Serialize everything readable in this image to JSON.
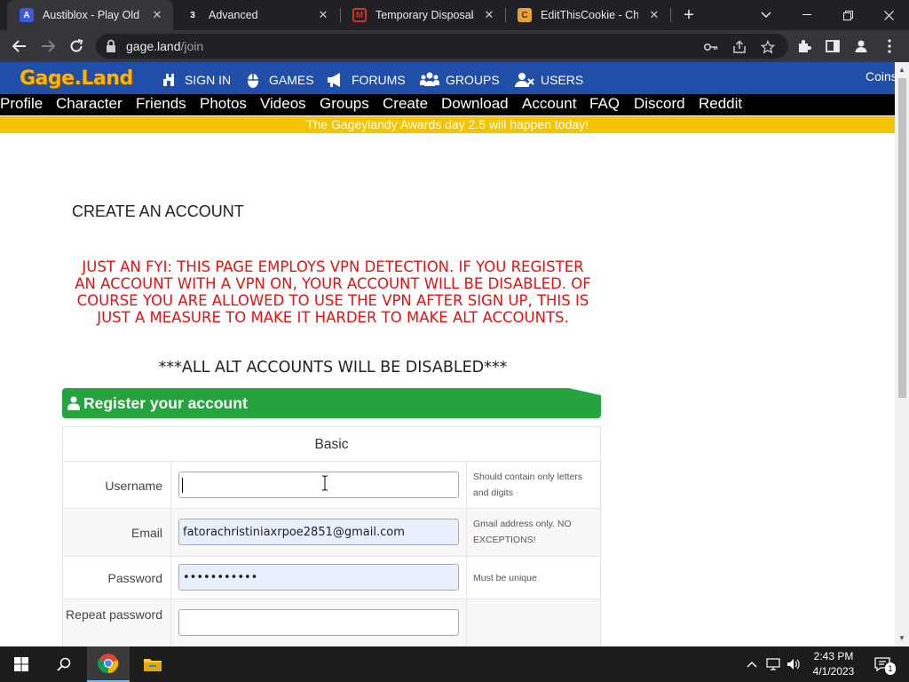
{
  "browser": {
    "tabs": [
      {
        "title": "Austiblox - Play Old Bri",
        "favicon": "A",
        "favicon_color": "#3b5bdb",
        "active": true
      },
      {
        "title": "Advanced",
        "favicon": "3",
        "favicon_color": "#ffffff",
        "active": false
      },
      {
        "title": "Temporary Disposable",
        "favicon": "M",
        "favicon_color": "#d93025",
        "active": false
      },
      {
        "title": "EditThisCookie - Chron",
        "favicon": "C",
        "favicon_color": "#e8a23a",
        "active": false
      }
    ],
    "url_host": "gage.land",
    "url_path": "/join"
  },
  "site": {
    "logo": "Gage.Land",
    "nav": [
      {
        "label": "SIGN IN",
        "icon": "sign-in-icon"
      },
      {
        "label": "GAMES",
        "icon": "games-icon"
      },
      {
        "label": "FORUMS",
        "icon": "forums-icon"
      },
      {
        "label": "GROUPS",
        "icon": "groups-icon"
      },
      {
        "label": "USERS",
        "icon": "users-icon"
      }
    ],
    "coins": "Coins",
    "menu": [
      "Profile",
      "Character",
      "Friends",
      "Photos",
      "Videos",
      "Groups",
      "Create",
      "Download",
      "Account",
      "FAQ",
      "Discord",
      "Reddit"
    ],
    "banner": "The Gageylandy Awards day 2.5 will happen today!"
  },
  "page": {
    "title": "CREATE AN ACCOUNT",
    "warning": "JUST AN FYI: THIS PAGE EMPLOYS VPN DETECTION. IF YOU REGISTER AN ACCOUNT WITH A VPN ON, YOUR ACCOUNT WILL BE DISABLED. OF COURSE YOU ARE ALLOWED TO USE THE VPN AFTER SIGN UP, THIS IS JUST A MEASURE TO MAKE IT HARDER TO MAKE ALT ACCOUNTS.",
    "alt_warning": "***ALL ALT ACCOUNTS WILL BE DISABLED***",
    "panel_title": "Register your account",
    "section": "Basic",
    "fields": {
      "username": {
        "label": "Username",
        "value": "",
        "hint": "Should contain only letters and digits"
      },
      "email": {
        "label": "Email",
        "value": "fatorachristiniaxrpoe2851@gmail.com",
        "hint": "Gmail address only. NO EXCEPTIONS!"
      },
      "password": {
        "label": "Password",
        "value": "•••••••••••",
        "hint": "Must be unique"
      },
      "repeat": {
        "label": "Repeat password",
        "value": ""
      }
    }
  },
  "taskbar": {
    "time": "2:43 PM",
    "date": "4/1/2023",
    "notifications": "1"
  },
  "colors": {
    "site_blue": "#1f4fa8",
    "logo_orange": "#ffb400",
    "banner_yellow": "#f4c400",
    "warning_red": "#e01414",
    "panel_green": "#26a23f"
  }
}
